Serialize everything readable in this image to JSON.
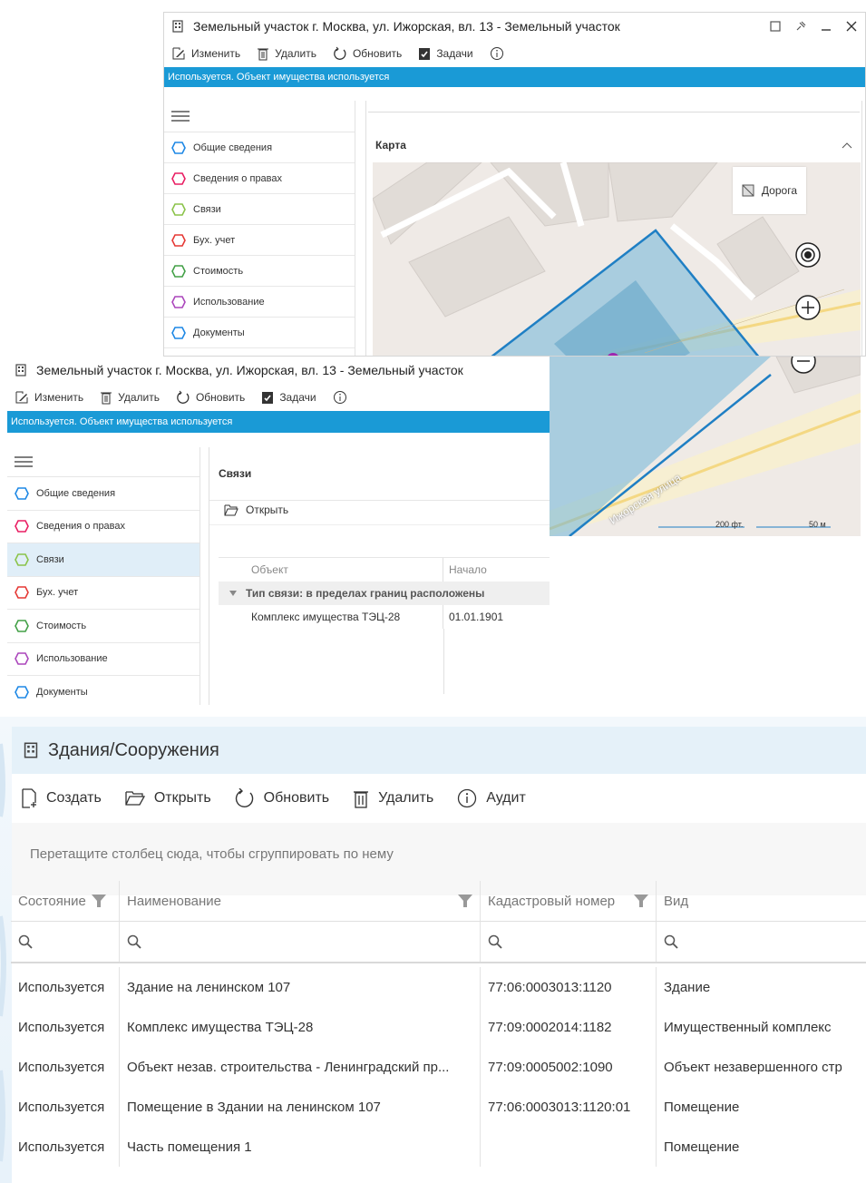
{
  "window_main": {
    "title": "Земельный участок г. Москва, ул. Ижорская, вл. 13 - Земельный участок",
    "toolbar": {
      "edit": "Изменить",
      "delete": "Удалить",
      "refresh": "Обновить",
      "tasks": "Задачи"
    },
    "status": "Используется. Объект имущества используется",
    "nav": [
      "Общие сведения",
      "Сведения о правах",
      "Связи",
      "Бух. учет",
      "Стоимость",
      "Использование",
      "Документы"
    ],
    "nav_colors": [
      "#1e88e5",
      "#e91e63",
      "#8bc34a",
      "#e53935",
      "#43a047",
      "#ab47bc",
      "#1e88e5"
    ],
    "map": {
      "title": "Карта",
      "legend": "Дорога",
      "street": "Ижорская улица",
      "scale_ft": "200 фт.",
      "scale_m": "50 м"
    }
  },
  "window_links": {
    "title": "Земельный участок г. Москва, ул. Ижорская, вл. 13 - Земельный участок",
    "toolbar": {
      "edit": "Изменить",
      "delete": "Удалить",
      "refresh": "Обновить",
      "tasks": "Задачи"
    },
    "status": "Используется. Объект имущества используется",
    "nav": [
      "Общие сведения",
      "Сведения о правах",
      "Связи",
      "Бух. учет",
      "Стоимость",
      "Использование",
      "Документы"
    ],
    "active_nav": "Связи",
    "section_title": "Связи",
    "open": "Открыть",
    "columns": [
      "Объект",
      "Начало"
    ],
    "group_label": "Тип связи: в пределах границ расположены",
    "rows": [
      {
        "object": "Комплекс имущества ТЭЦ-28",
        "start": "01.01.1901"
      }
    ]
  },
  "buildings": {
    "title": "Здания/Сооружения",
    "toolbar": {
      "create": "Создать",
      "open": "Открыть",
      "refresh": "Обновить",
      "delete": "Удалить",
      "audit": "Аудит"
    },
    "group_hint": "Перетащите столбец сюда, чтобы сгруппировать по нему",
    "columns": [
      "Состояние",
      "Наименование",
      "Кадастровый номер",
      "Вид"
    ],
    "rows": [
      {
        "state": "Используется",
        "name": "Здание на ленинском 107",
        "cadastral": "77:06:0003013:1120",
        "kind": "Здание"
      },
      {
        "state": "Используется",
        "name": "Комплекс имущества ТЭЦ-28",
        "cadastral": "77:09:0002014:1182",
        "kind": "Имущественный комплекс"
      },
      {
        "state": "Используется",
        "name": "Объект незав. строительства - Ленинградский пр...",
        "cadastral": "77:09:0005002:1090",
        "kind": "Объект незавершенного стр"
      },
      {
        "state": "Используется",
        "name": "Помещение в Здании на ленинском 107",
        "cadastral": "77:06:0003013:1120:01",
        "kind": "Помещение"
      },
      {
        "state": "Используется",
        "name": "Часть помещения 1",
        "cadastral": "",
        "kind": "Помещение"
      }
    ]
  }
}
